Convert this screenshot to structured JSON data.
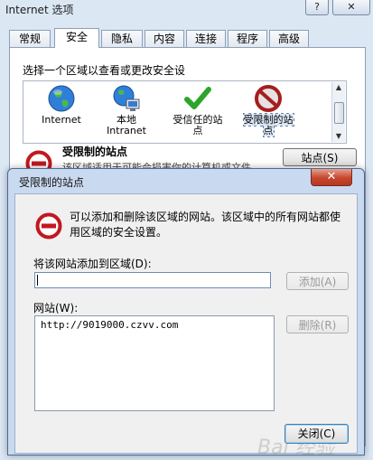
{
  "parent_window": {
    "title": "Internet 选项",
    "help_button": "?",
    "close_button": "✕",
    "tabs": [
      "常规",
      "安全",
      "隐私",
      "内容",
      "连接",
      "程序",
      "高级"
    ],
    "active_tab": "安全",
    "zone_prompt": "选择一个区域以查看或更改安全设",
    "zones": [
      {
        "label": "Internet",
        "icon": "globe-icon"
      },
      {
        "label": "本地\nIntranet",
        "icon": "network-globe-icon"
      },
      {
        "label": "受信任的站\n点",
        "icon": "checkmark-icon"
      },
      {
        "label": "受限制的站\n点",
        "icon": "no-entry-icon"
      }
    ],
    "selected_zone": "受限制的站点",
    "restricted_heading": "受限制的站点",
    "restricted_desc_partial": "该区域适用于可能会损害你的计算机或文件",
    "sites_button": "站点(S)"
  },
  "dialog": {
    "title": "受限制的站点",
    "close_button": "✕",
    "info_text": "可以添加和删除该区域的网站。该区域中的所有网站都使用区域的安全设置。",
    "add_label": "将该网站添加到区域(D):",
    "add_input_value": "",
    "add_button": "添加(A)",
    "sites_label": "网站(W):",
    "sites": [
      "http://9019000.czvv.com"
    ],
    "remove_button": "删除(R)",
    "close_label": "关闭(C)"
  },
  "watermark": "Bai 经验",
  "colors": {
    "accent_blue": "#3c7fb1",
    "close_red": "#c6462d",
    "dialog_frame": "#c9daf0"
  }
}
